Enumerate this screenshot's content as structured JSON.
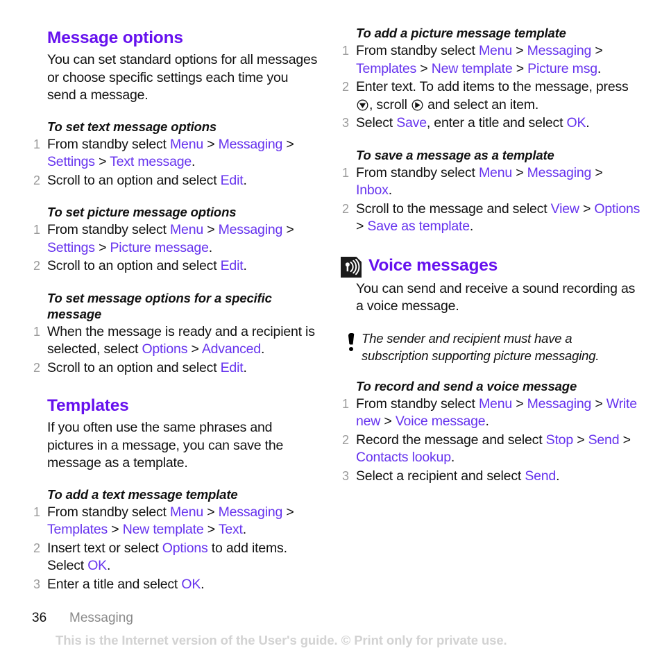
{
  "document": {
    "type": "user-guide-page",
    "colors": {
      "heading": "#6611ee",
      "link": "#6633ee",
      "body": "#111111",
      "step_number": "#9b9b9b",
      "footer_chapter": "#8a8a8a",
      "watermark": "#d2d2d2",
      "background": "#ffffff"
    }
  },
  "left_column": {
    "message_options": {
      "title": "Message options",
      "intro": "You can set standard options for all messages or choose specific settings each time you send a message.",
      "tasks": [
        {
          "title": "To set text message options",
          "steps": [
            [
              {
                "t": "text",
                "v": "From standby select "
              },
              {
                "t": "link",
                "v": "Menu"
              },
              {
                "t": "text",
                "v": " > "
              },
              {
                "t": "link",
                "v": "Messaging"
              },
              {
                "t": "text",
                "v": " > "
              },
              {
                "t": "link",
                "v": "Settings"
              },
              {
                "t": "text",
                "v": " > "
              },
              {
                "t": "link",
                "v": "Text message"
              },
              {
                "t": "text",
                "v": "."
              }
            ],
            [
              {
                "t": "text",
                "v": "Scroll to an option and select "
              },
              {
                "t": "link",
                "v": "Edit"
              },
              {
                "t": "text",
                "v": "."
              }
            ]
          ]
        },
        {
          "title": "To set picture message options",
          "steps": [
            [
              {
                "t": "text",
                "v": "From standby select "
              },
              {
                "t": "link",
                "v": "Menu"
              },
              {
                "t": "text",
                "v": " > "
              },
              {
                "t": "link",
                "v": "Messaging"
              },
              {
                "t": "text",
                "v": " > "
              },
              {
                "t": "link",
                "v": "Settings"
              },
              {
                "t": "text",
                "v": " > "
              },
              {
                "t": "link",
                "v": "Picture message"
              },
              {
                "t": "text",
                "v": "."
              }
            ],
            [
              {
                "t": "text",
                "v": "Scroll to an option and select "
              },
              {
                "t": "link",
                "v": "Edit"
              },
              {
                "t": "text",
                "v": "."
              }
            ]
          ]
        },
        {
          "title": "To set message options for a specific message",
          "steps": [
            [
              {
                "t": "text",
                "v": "When the message is ready and a recipient is selected, select "
              },
              {
                "t": "link",
                "v": "Options"
              },
              {
                "t": "text",
                "v": " > "
              },
              {
                "t": "link",
                "v": "Advanced"
              },
              {
                "t": "text",
                "v": "."
              }
            ],
            [
              {
                "t": "text",
                "v": "Scroll to an option and select "
              },
              {
                "t": "link",
                "v": "Edit"
              },
              {
                "t": "text",
                "v": "."
              }
            ]
          ]
        }
      ]
    },
    "templates": {
      "title": "Templates",
      "intro": "If you often use the same phrases and pictures in a message, you can save the message as a template.",
      "tasks": [
        {
          "title": "To add a text message template",
          "steps": [
            [
              {
                "t": "text",
                "v": "From standby select "
              },
              {
                "t": "link",
                "v": "Menu"
              },
              {
                "t": "text",
                "v": " > "
              },
              {
                "t": "link",
                "v": "Messaging"
              },
              {
                "t": "text",
                "v": " > "
              },
              {
                "t": "link",
                "v": "Templates"
              },
              {
                "t": "text",
                "v": " > "
              },
              {
                "t": "link",
                "v": "New template"
              },
              {
                "t": "text",
                "v": " > "
              },
              {
                "t": "link",
                "v": "Text"
              },
              {
                "t": "text",
                "v": "."
              }
            ],
            [
              {
                "t": "text",
                "v": "Insert text or select "
              },
              {
                "t": "link",
                "v": "Options"
              },
              {
                "t": "text",
                "v": " to add items. Select "
              },
              {
                "t": "link",
                "v": "OK"
              },
              {
                "t": "text",
                "v": "."
              }
            ],
            [
              {
                "t": "text",
                "v": "Enter a title and select "
              },
              {
                "t": "link",
                "v": "OK"
              },
              {
                "t": "text",
                "v": "."
              }
            ]
          ]
        }
      ]
    }
  },
  "right_column": {
    "picture_template_task": {
      "title": "To add a picture message template",
      "steps": [
        [
          {
            "t": "text",
            "v": "From standby select "
          },
          {
            "t": "link",
            "v": "Menu"
          },
          {
            "t": "text",
            "v": " > "
          },
          {
            "t": "link",
            "v": "Messaging"
          },
          {
            "t": "text",
            "v": " > "
          },
          {
            "t": "link",
            "v": "Templates"
          },
          {
            "t": "text",
            "v": " > "
          },
          {
            "t": "link",
            "v": "New template"
          },
          {
            "t": "text",
            "v": " > "
          },
          {
            "t": "link",
            "v": "Picture msg"
          },
          {
            "t": "text",
            "v": "."
          }
        ],
        [
          {
            "t": "text",
            "v": "Enter text. To add items to the message, press "
          },
          {
            "t": "icon",
            "v": "joystick-press-icon"
          },
          {
            "t": "text",
            "v": ", scroll "
          },
          {
            "t": "icon",
            "v": "joystick-right-icon"
          },
          {
            "t": "text",
            "v": " and select an item."
          }
        ],
        [
          {
            "t": "text",
            "v": "Select "
          },
          {
            "t": "link",
            "v": "Save"
          },
          {
            "t": "text",
            "v": ", enter a title and select "
          },
          {
            "t": "link",
            "v": "OK"
          },
          {
            "t": "text",
            "v": "."
          }
        ]
      ]
    },
    "save_template_task": {
      "title": "To save a message as a template",
      "steps": [
        [
          {
            "t": "text",
            "v": "From standby select "
          },
          {
            "t": "link",
            "v": "Menu"
          },
          {
            "t": "text",
            "v": " > "
          },
          {
            "t": "link",
            "v": "Messaging"
          },
          {
            "t": "text",
            "v": " > "
          },
          {
            "t": "link",
            "v": "Inbox"
          },
          {
            "t": "text",
            "v": "."
          }
        ],
        [
          {
            "t": "text",
            "v": "Scroll to the message and select "
          },
          {
            "t": "link",
            "v": "View"
          },
          {
            "t": "text",
            "v": " > "
          },
          {
            "t": "link",
            "v": "Options"
          },
          {
            "t": "text",
            "v": " > "
          },
          {
            "t": "link",
            "v": "Save as template"
          },
          {
            "t": "text",
            "v": "."
          }
        ]
      ]
    },
    "voice_messages": {
      "icon": "voice-message-icon",
      "title": "Voice messages",
      "intro": "You can send and receive a sound recording as a voice message.",
      "note": {
        "icon": "exclamation-icon",
        "text": "The sender and recipient must have a subscription supporting picture messaging."
      },
      "tasks": [
        {
          "title": "To record and send a voice message",
          "steps": [
            [
              {
                "t": "text",
                "v": "From standby select "
              },
              {
                "t": "link",
                "v": "Menu"
              },
              {
                "t": "text",
                "v": " > "
              },
              {
                "t": "link",
                "v": "Messaging"
              },
              {
                "t": "text",
                "v": " > "
              },
              {
                "t": "link",
                "v": "Write new"
              },
              {
                "t": "text",
                "v": " > "
              },
              {
                "t": "link",
                "v": "Voice message"
              },
              {
                "t": "text",
                "v": "."
              }
            ],
            [
              {
                "t": "text",
                "v": "Record the message and select "
              },
              {
                "t": "link",
                "v": "Stop"
              },
              {
                "t": "text",
                "v": " > "
              },
              {
                "t": "link",
                "v": "Send"
              },
              {
                "t": "text",
                "v": " > "
              },
              {
                "t": "link",
                "v": "Contacts lookup"
              },
              {
                "t": "text",
                "v": "."
              }
            ],
            [
              {
                "t": "text",
                "v": "Select a recipient and select "
              },
              {
                "t": "link",
                "v": "Send"
              },
              {
                "t": "text",
                "v": "."
              }
            ]
          ]
        }
      ]
    }
  },
  "footer": {
    "page_number": "36",
    "chapter": "Messaging",
    "watermark": "This is the Internet version of the User's guide. © Print only for private use."
  }
}
